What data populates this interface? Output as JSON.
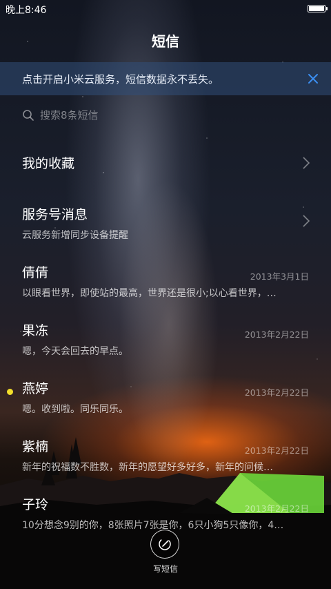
{
  "status_bar": {
    "time": "晚上8:46"
  },
  "header": {
    "title": "短信"
  },
  "banner": {
    "text": "点击开启小米云服务，短信数据永不丢失。",
    "close_icon": "close-icon",
    "accent_color": "#3b8ef0"
  },
  "search": {
    "placeholder": "搜索8条短信",
    "value": ""
  },
  "conversations": [
    {
      "title": "我的收藏",
      "subtitle": "",
      "date": "",
      "unread": false,
      "has_chevron": true
    },
    {
      "title": "服务号消息",
      "subtitle": "云服务新增同步设备提醒",
      "date": "",
      "unread": false,
      "has_chevron": true
    },
    {
      "title": "倩倩",
      "subtitle": "以眼看世界，即使站的最高，世界还是很小;以心看世界，…",
      "date": "2013年3月1日",
      "unread": false,
      "has_chevron": false
    },
    {
      "title": "果冻",
      "subtitle": "嗯，今天会回去的早点。",
      "date": "2013年2月22日",
      "unread": false,
      "has_chevron": false
    },
    {
      "title": "燕婷",
      "subtitle": "嗯。收到啦。同乐同乐。",
      "date": "2013年2月22日",
      "unread": true,
      "has_chevron": false
    },
    {
      "title": "紫楠",
      "subtitle": "新年的祝福数不胜数，新年的愿望好多好多，新年的问候…",
      "date": "2013年2月22日",
      "unread": false,
      "has_chevron": false
    },
    {
      "title": "子玲",
      "subtitle": "10分想念9别的你，8张照片7张是你，6只小狗5只像你，4…",
      "date": "2013年2月22日",
      "unread": false,
      "has_chevron": false
    }
  ],
  "compose": {
    "label": "写短信",
    "icon": "compose-icon"
  },
  "colors": {
    "unread_dot": "#f3df2b"
  }
}
